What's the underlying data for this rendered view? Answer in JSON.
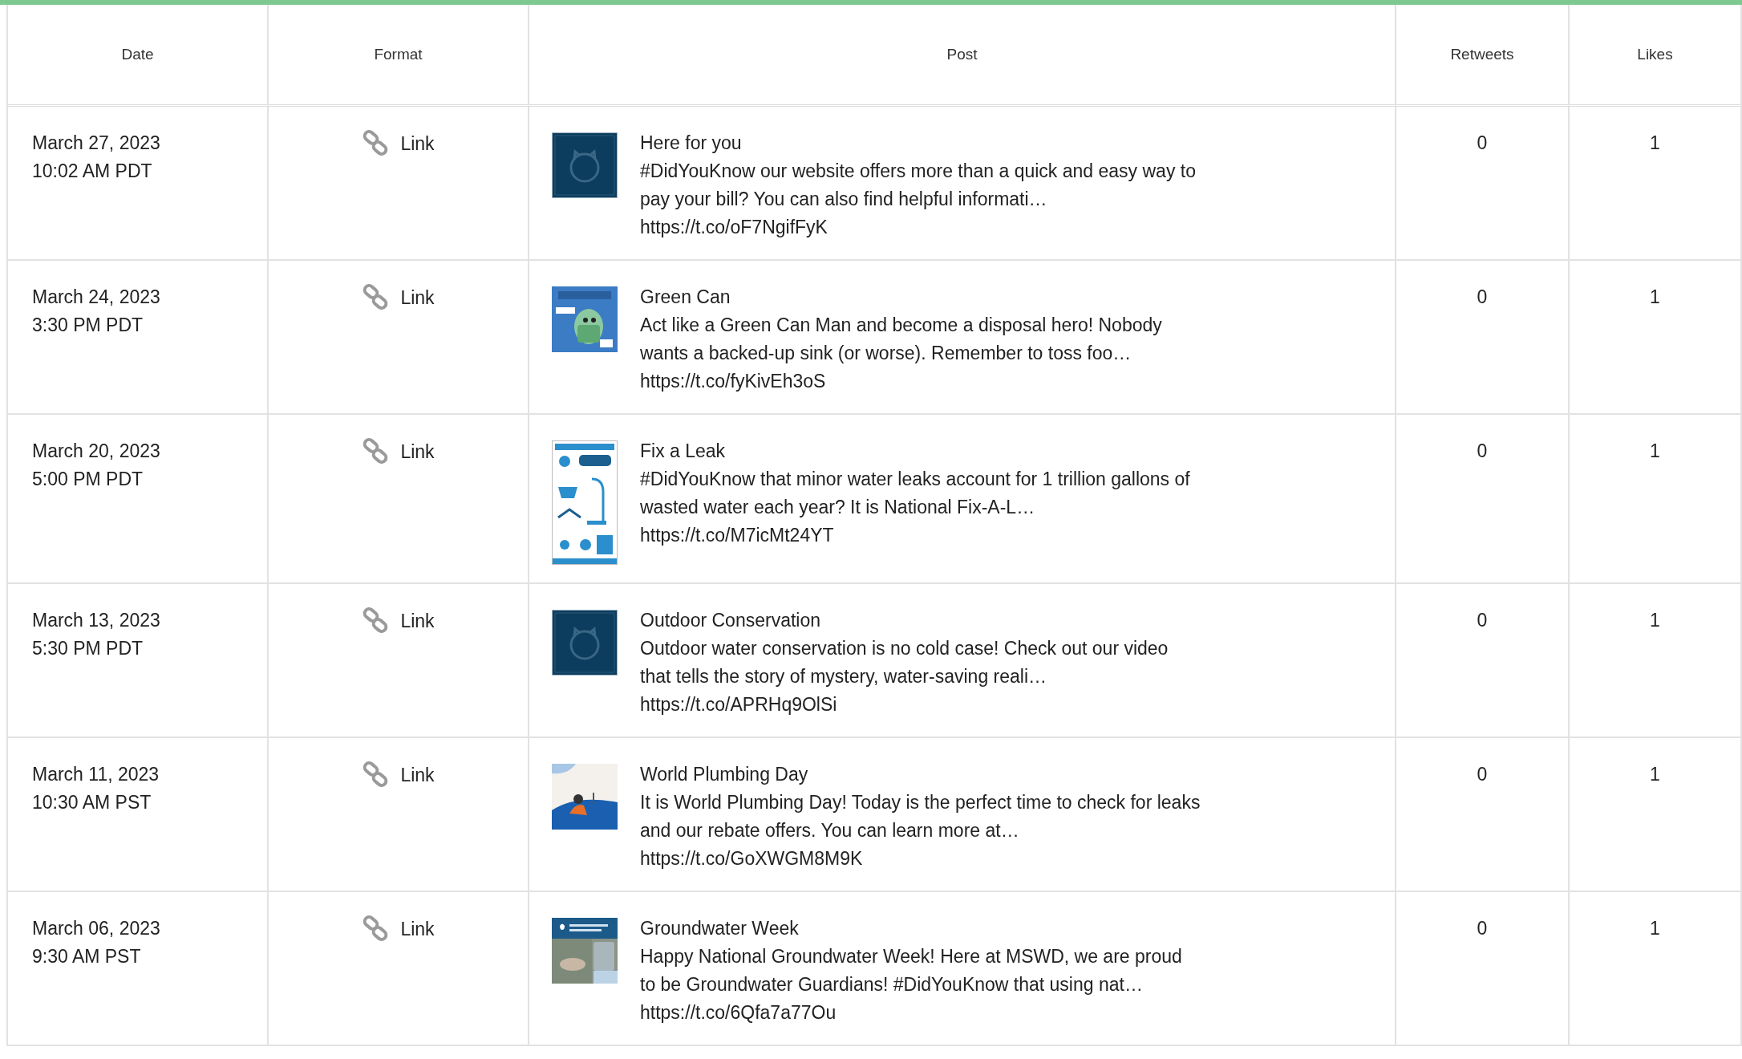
{
  "table": {
    "columns": [
      "Date",
      "Format",
      "Post",
      "Retweets",
      "Likes"
    ],
    "rows": [
      {
        "date": "March 27, 2023",
        "time": "10:02 AM PDT",
        "format": "Link",
        "kind": "logo",
        "title": "Here for you",
        "body": "#DidYouKnow our website offers more than a quick and easy way to pay your bill? You can also find helpful informati…",
        "url": "https://t.co/oF7NgifFyK",
        "retweets": "0",
        "likes": "1"
      },
      {
        "date": "March 24, 2023",
        "time": "3:30 PM PDT",
        "format": "Link",
        "kind": "illustration",
        "title": "Green Can",
        "body": "Act like a Green Can Man and become a disposal hero! Nobody wants a backed-up sink (or worse). Remember to toss foo…",
        "url": "https://t.co/fyKivEh3oS",
        "retweets": "0",
        "likes": "1"
      },
      {
        "date": "March 20, 2023",
        "time": "5:00 PM PDT",
        "format": "Link",
        "kind": "poster",
        "title": "Fix a Leak",
        "body": "#DidYouKnow that minor water leaks account for 1 trillion gallons of wasted water each year? It is National Fix-A-L…",
        "url": "https://t.co/M7icMt24YT",
        "retweets": "0",
        "likes": "1"
      },
      {
        "date": "March 13, 2023",
        "time": "5:30 PM PDT",
        "format": "Link",
        "kind": "logo",
        "title": "Outdoor Conservation",
        "body": "Outdoor water conservation is no cold case! Check out our video that tells the story of mystery, water-saving reali…",
        "url": "https://t.co/APRHq9OlSi",
        "retweets": "0",
        "likes": "1"
      },
      {
        "date": "March 11, 2023",
        "time": "10:30 AM PST",
        "format": "Link",
        "kind": "wave",
        "title": "World Plumbing Day",
        "body": "It is World Plumbing Day! Today is the perfect time to check for leaks and our rebate offers. You can learn more at…",
        "url": "https://t.co/GoXWGM8M9K",
        "retweets": "0",
        "likes": "1"
      },
      {
        "date": "March 06, 2023",
        "time": "9:30 AM PST",
        "format": "Link",
        "kind": "photo",
        "title": "Groundwater Week",
        "body": "Happy National Groundwater Week! Here at MSWD, we are proud to be Groundwater Guardians! #DidYouKnow that using nat…",
        "url": "https://t.co/6Qfa7a77Ou",
        "retweets": "0",
        "likes": "1"
      }
    ]
  }
}
